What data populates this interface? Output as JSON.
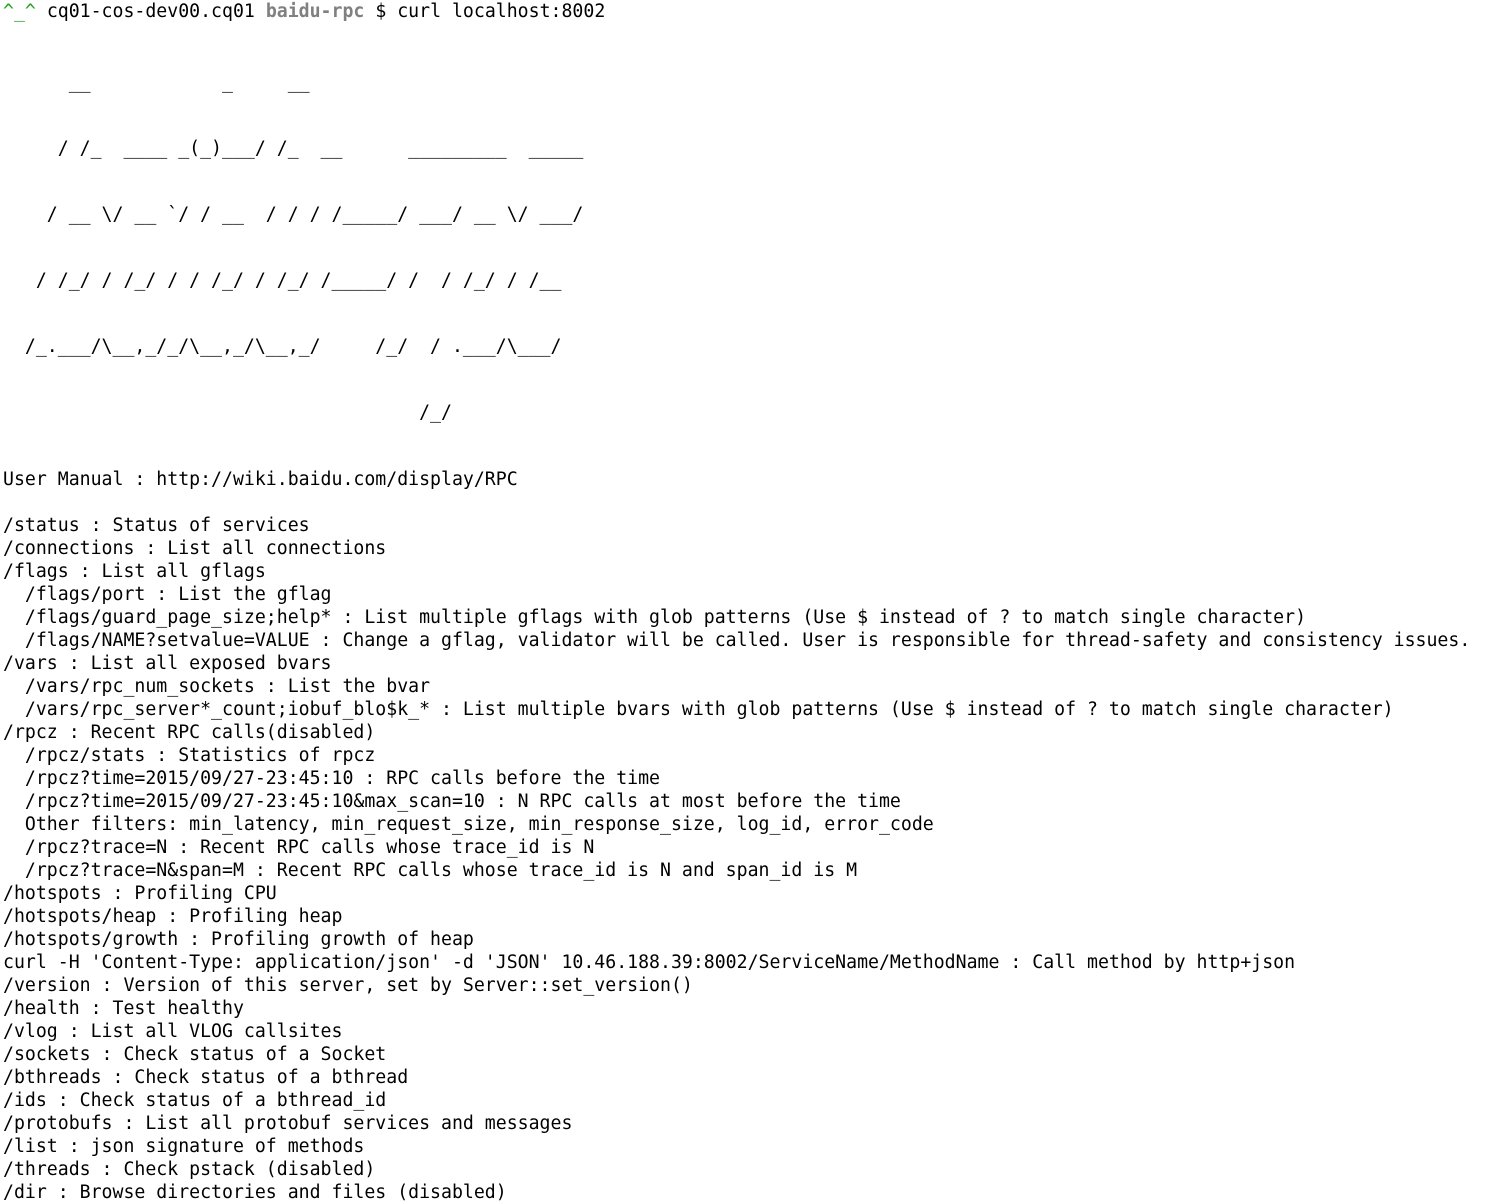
{
  "prompt": {
    "face": "^_^",
    "host": "cq01-cos-dev00.cq01",
    "dir": "baidu-rpc",
    "dollar": "$",
    "command": "curl localhost:8002"
  },
  "banner": [
    "      __            _     __",
    "     / /_  ____ _(_)___/ /_  __      _________  _____",
    "    / __ \\/ __ `/ / __  / / / /_____/ ___/ __ \\/ ___/",
    "   / /_/ / /_/ / / /_/ / /_/ /_____/ /  / /_/ / /__",
    "  /_.___/\\__,_/_/\\__,_/\\__,_/     /_/  / .___/\\___/",
    "                                      /_/"
  ],
  "output": [
    "User Manual : http://wiki.baidu.com/display/RPC",
    "",
    "/status : Status of services",
    "/connections : List all connections",
    "/flags : List all gflags",
    "  /flags/port : List the gflag",
    "  /flags/guard_page_size;help* : List multiple gflags with glob patterns (Use $ instead of ? to match single character)",
    "  /flags/NAME?setvalue=VALUE : Change a gflag, validator will be called. User is responsible for thread-safety and consistency issues.",
    "/vars : List all exposed bvars",
    "  /vars/rpc_num_sockets : List the bvar",
    "  /vars/rpc_server*_count;iobuf_blo$k_* : List multiple bvars with glob patterns (Use $ instead of ? to match single character)",
    "/rpcz : Recent RPC calls(disabled)",
    "  /rpcz/stats : Statistics of rpcz",
    "  /rpcz?time=2015/09/27-23:45:10 : RPC calls before the time",
    "  /rpcz?time=2015/09/27-23:45:10&max_scan=10 : N RPC calls at most before the time",
    "  Other filters: min_latency, min_request_size, min_response_size, log_id, error_code",
    "  /rpcz?trace=N : Recent RPC calls whose trace_id is N",
    "  /rpcz?trace=N&span=M : Recent RPC calls whose trace_id is N and span_id is M",
    "/hotspots : Profiling CPU",
    "/hotspots/heap : Profiling heap",
    "/hotspots/growth : Profiling growth of heap",
    "curl -H 'Content-Type: application/json' -d 'JSON' 10.46.188.39:8002/ServiceName/MethodName : Call method by http+json",
    "/version : Version of this server, set by Server::set_version()",
    "/health : Test healthy",
    "/vlog : List all VLOG callsites",
    "/sockets : Check status of a Socket",
    "/bthreads : Check status of a bthread",
    "/ids : Check status of a bthread_id",
    "/protobufs : List all protobuf services and messages",
    "/list : json signature of methods",
    "/threads : Check pstack (disabled)",
    "/dir : Browse directories and files (disabled)"
  ]
}
